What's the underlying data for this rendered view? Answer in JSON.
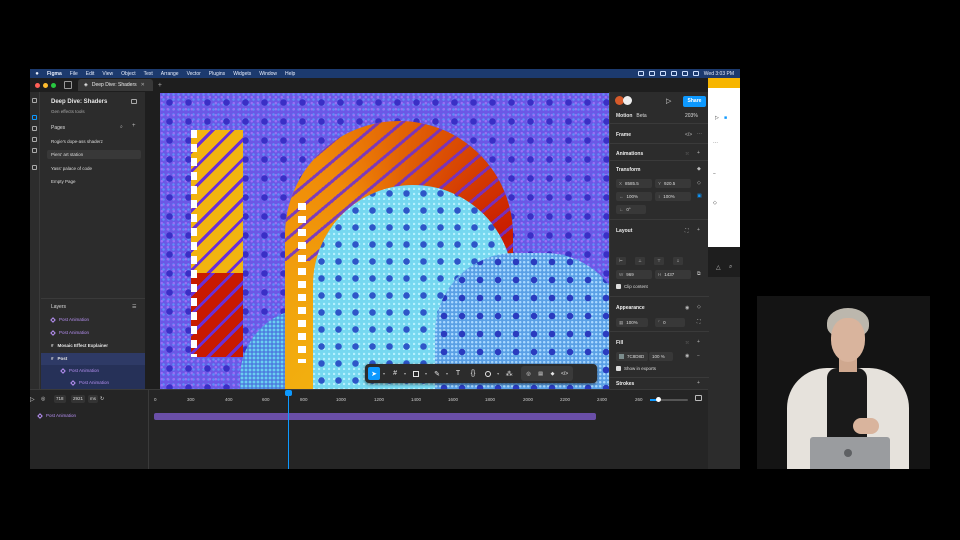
{
  "menubar": {
    "app": "Figma",
    "items": [
      "File",
      "Edit",
      "View",
      "Object",
      "Text",
      "Arrange",
      "Vector",
      "Plugins",
      "Widgets",
      "Window",
      "Help"
    ],
    "clock": "Wed 3:03 PM"
  },
  "window": {
    "tab_title": "Deep Dive: Shaders"
  },
  "left_panel": {
    "file_name": "Deep Dive: Shaders",
    "file_sub": "Gen effects tools",
    "pages_label": "Pages",
    "pages": [
      {
        "label": "Rogie's dope-ass shaderz",
        "selected": false
      },
      {
        "label": "Piers' art station",
        "selected": true
      },
      {
        "label": "Yass' palace of code",
        "selected": false
      },
      {
        "label": "Empty Page",
        "selected": false
      }
    ],
    "layers_label": "Layers",
    "layers": [
      {
        "label": "Post Animation",
        "kind": "anim",
        "indent": 0
      },
      {
        "label": "Post Animation",
        "kind": "anim",
        "indent": 0
      },
      {
        "label": "Mosaic Effect Explainer",
        "kind": "plain",
        "indent": 0
      },
      {
        "label": "Post",
        "kind": "plain",
        "indent": 0
      },
      {
        "label": "Post Animation",
        "kind": "anim",
        "indent": 1
      },
      {
        "label": "Post Animation",
        "kind": "anim",
        "indent": 2
      }
    ]
  },
  "right_panel": {
    "share_label": "Share",
    "tab_motion": "Motion",
    "tab_beta": "Beta",
    "zoom": "203%",
    "frame_label": "Frame",
    "animations_label": "Animations",
    "transform_label": "Transform",
    "x_label": "X",
    "x_value": "8585.5",
    "y_label": "Y",
    "y_value": "920.5",
    "scale_x": "100%",
    "scale_y": "100%",
    "rotation": "0°",
    "layout_label": "Layout",
    "w_label": "W",
    "w_value": "969",
    "h_label": "H",
    "h_value": "1437",
    "clip_content": "Clip content",
    "appearance_label": "Appearance",
    "opacity": "100%",
    "radius": "0",
    "fill_label": "Fill",
    "fill_hex": "7C8D8D",
    "fill_opacity": "100",
    "fill_percent": "%",
    "show_exports": "Show in exports",
    "strokes_label": "Strokes"
  },
  "timeline": {
    "current_time": "718",
    "total_time": "2921",
    "unit": "ms",
    "ticks": [
      "0",
      "300",
      "400",
      "600",
      "800",
      "1000",
      "1200",
      "1400",
      "1600",
      "1800",
      "2000",
      "2200",
      "2400",
      "260"
    ],
    "track_label": "Post Animation"
  },
  "colors": {
    "accent": "#0d99ff",
    "anim": "#b48ef0",
    "panel": "#2c2c2c",
    "menubar": "#1c3a6e"
  }
}
